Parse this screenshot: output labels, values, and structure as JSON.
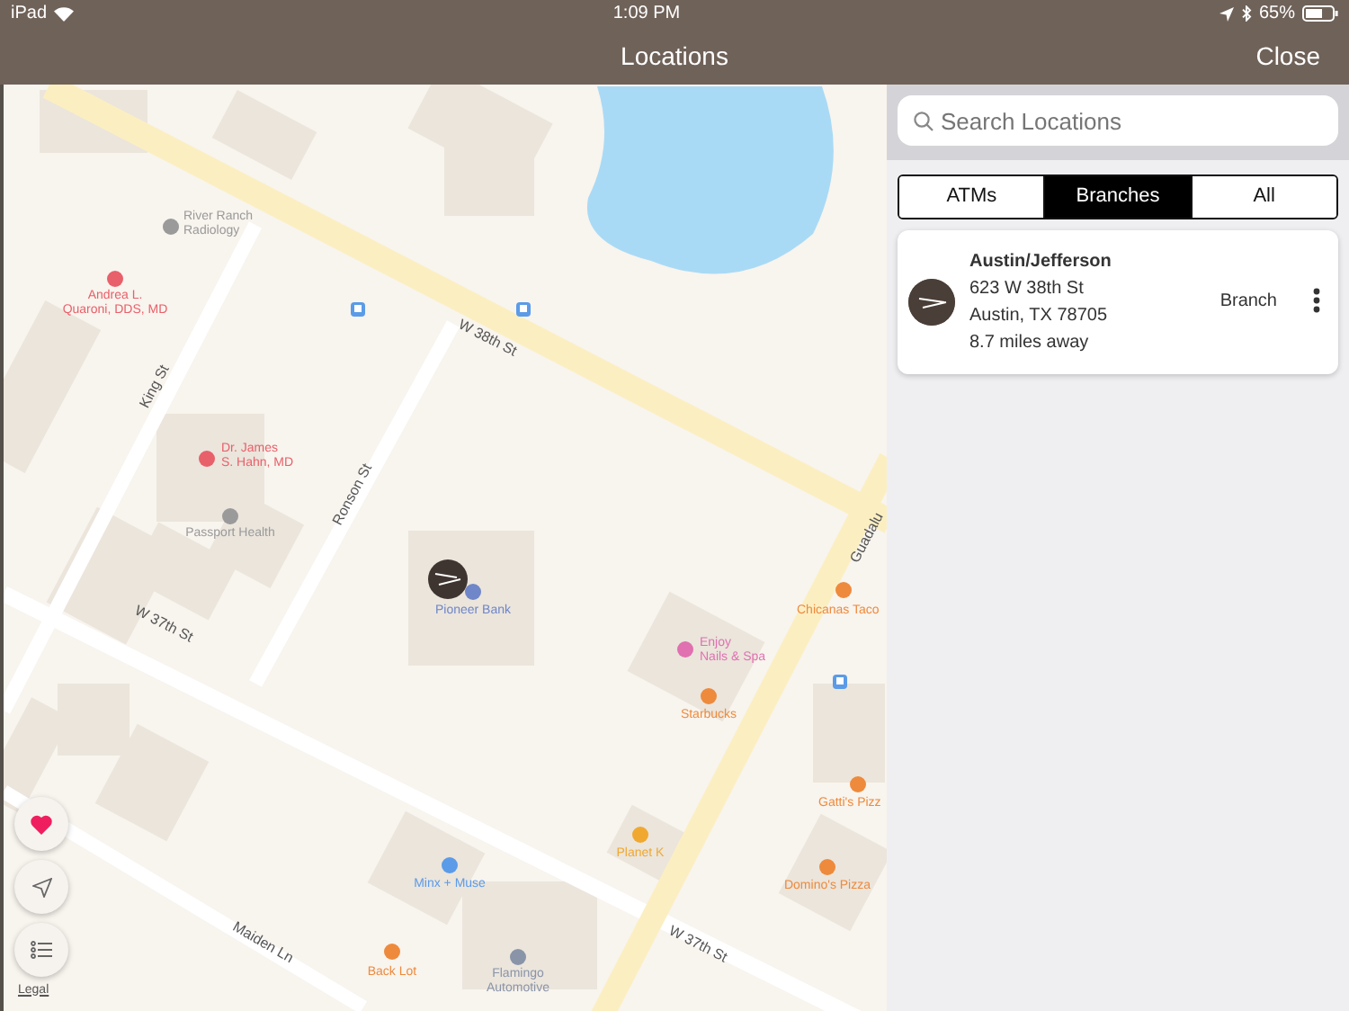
{
  "status_bar": {
    "device": "iPad",
    "time": "1:09 PM",
    "battery": "65%"
  },
  "nav_bar": {
    "title": "Locations",
    "close": "Close"
  },
  "map": {
    "streets": [
      "W 38th St",
      "King St",
      "Ronson St",
      "W 37th St",
      "W 37th St",
      "Maiden Ln",
      "Guadalu"
    ],
    "places": [
      {
        "lines": [
          "River Ranch",
          "Radiology"
        ],
        "color": "#9a9a9a"
      },
      {
        "lines": [
          "Andrea L.",
          "Quaroni, DDS, MD"
        ],
        "color": "#e8606a"
      },
      {
        "lines": [
          "Dr. James",
          "S. Hahn, MD"
        ],
        "color": "#e8606a"
      },
      {
        "lines": [
          "Passport Health"
        ],
        "color": "#9a9a9a"
      },
      {
        "lines": [
          "Pioneer Bank"
        ],
        "color": "#6f86c8"
      },
      {
        "lines": [
          "Chicanas Taco"
        ],
        "color": "#ee8a3c"
      },
      {
        "lines": [
          "Enjoy",
          "Nails & Spa"
        ],
        "color": "#e070b0"
      },
      {
        "lines": [
          "Starbucks"
        ],
        "color": "#ee8a3c"
      },
      {
        "lines": [
          "Gatti's Pizz"
        ],
        "color": "#ee8a3c"
      },
      {
        "lines": [
          "Planet K"
        ],
        "color": "#f0a830"
      },
      {
        "lines": [
          "Domino's Pizza"
        ],
        "color": "#ee8a3c"
      },
      {
        "lines": [
          "Minx + Muse"
        ],
        "color": "#5b9be8"
      },
      {
        "lines": [
          "Back Lot"
        ],
        "color": "#ee8a3c"
      },
      {
        "lines": [
          "Flamingo",
          "Automotive"
        ],
        "color": "#8a94a8"
      }
    ],
    "legal": "Legal"
  },
  "search": {
    "placeholder": "Search Locations"
  },
  "filter_tabs": [
    {
      "label": "ATMs",
      "selected": false
    },
    {
      "label": "Branches",
      "selected": true
    },
    {
      "label": "All",
      "selected": false
    }
  ],
  "results": [
    {
      "name": "Austin/Jefferson",
      "address_lines": [
        "623 W 38th St",
        "Austin, TX 78705"
      ],
      "distance": "8.7 miles away",
      "type": "Branch"
    }
  ]
}
